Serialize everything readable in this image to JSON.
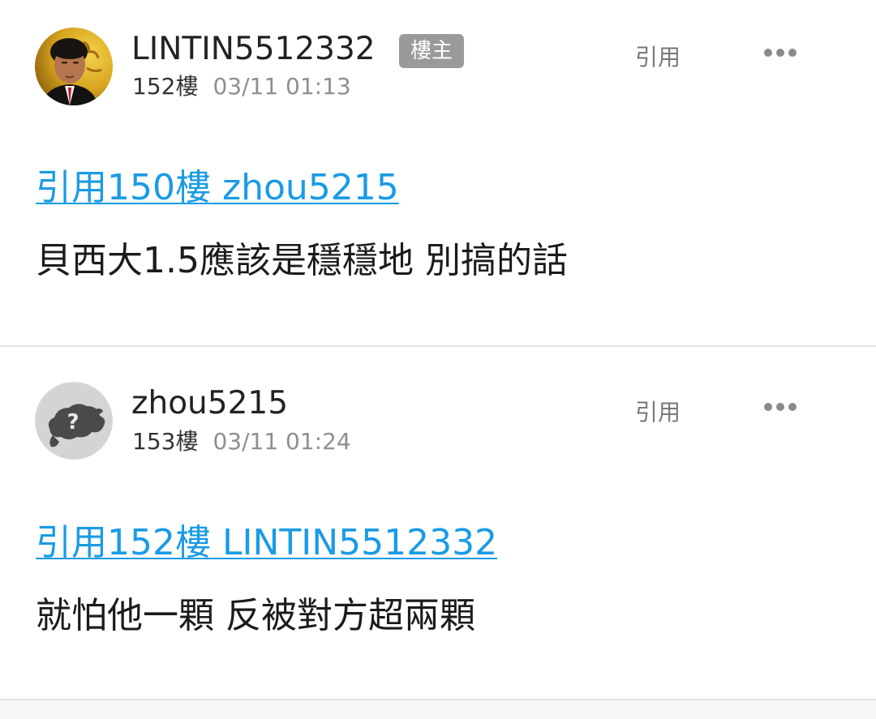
{
  "posts": [
    {
      "username": "LINTIN5512332",
      "op_badge": "樓主",
      "floor": "152樓",
      "time": "03/11 01:13",
      "quote_action": "引用",
      "more_icon": "more-horizontal-icon",
      "quote_link": "引用150樓 zhou5215",
      "content": "貝西大1.5應該是穩穩地 別搞的話"
    },
    {
      "username": "zhou5215",
      "floor": "153樓",
      "time": "03/11 01:24",
      "quote_action": "引用",
      "more_icon": "more-horizontal-icon",
      "quote_link": "引用152樓 LINTIN5512332",
      "content": "就怕他一顆 反被對方超兩顆"
    }
  ],
  "colors": {
    "link": "#1a9be5",
    "badge_bg": "#9a9a9a",
    "meta_gray": "#8e8e93",
    "divider": "#e3e3e6"
  }
}
